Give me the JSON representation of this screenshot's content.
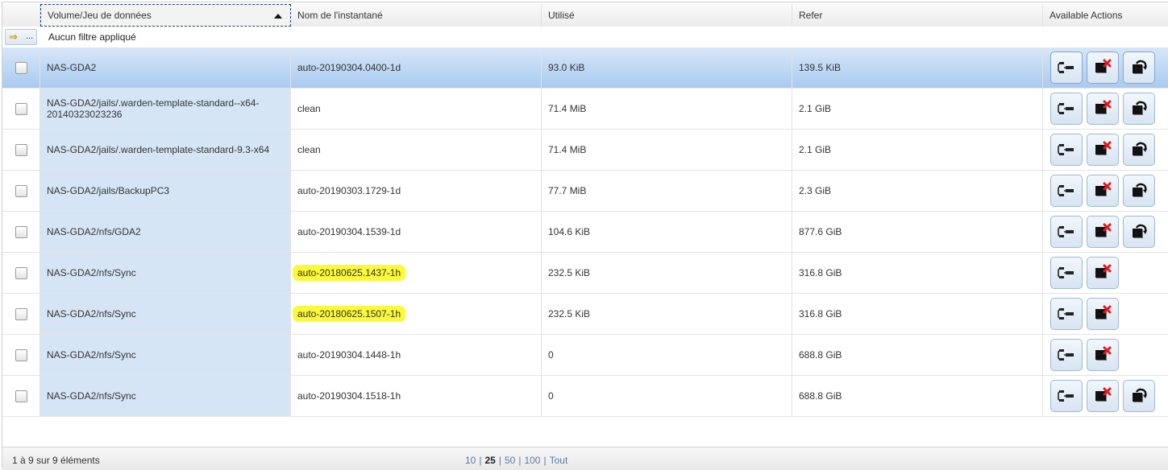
{
  "columns": {
    "volume": "Volume/Jeu de données",
    "snapshot": "Nom de l'instantané",
    "used": "Utilisé",
    "refer": "Refer",
    "actions": "Available Actions"
  },
  "filter": {
    "button_dots": "...",
    "status": "Aucun filtre appliqué"
  },
  "rows": [
    {
      "volume": "NAS-GDA2",
      "snapshot": "auto-20190304.0400-1d",
      "used": "93.0 KiB",
      "refer": "139.5 KiB",
      "selected": true,
      "highlighted": false,
      "rollback": true
    },
    {
      "volume": "NAS-GDA2/jails/.warden-template-standard--x64-20140323023236",
      "snapshot": "clean",
      "used": "71.4 MiB",
      "refer": "2.1 GiB",
      "selected": false,
      "highlighted": false,
      "rollback": true
    },
    {
      "volume": "NAS-GDA2/jails/.warden-template-standard-9.3-x64",
      "snapshot": "clean",
      "used": "71.4 MiB",
      "refer": "2.1 GiB",
      "selected": false,
      "highlighted": false,
      "rollback": true
    },
    {
      "volume": "NAS-GDA2/jails/BackupPC3",
      "snapshot": "auto-20190303.1729-1d",
      "used": "77.7 MiB",
      "refer": "2.3 GiB",
      "selected": false,
      "highlighted": false,
      "rollback": true
    },
    {
      "volume": "NAS-GDA2/nfs/GDA2",
      "snapshot": "auto-20190304.1539-1d",
      "used": "104.6 KiB",
      "refer": "877.6 GiB",
      "selected": false,
      "highlighted": false,
      "rollback": true
    },
    {
      "volume": "NAS-GDA2/nfs/Sync",
      "snapshot": "auto-20180625.1437-1h",
      "used": "232.5 KiB",
      "refer": "316.8 GiB",
      "selected": false,
      "highlighted": true,
      "rollback": false
    },
    {
      "volume": "NAS-GDA2/nfs/Sync",
      "snapshot": "auto-20180625.1507-1h",
      "used": "232.5 KiB",
      "refer": "316.8 GiB",
      "selected": false,
      "highlighted": true,
      "rollback": false
    },
    {
      "volume": "NAS-GDA2/nfs/Sync",
      "snapshot": "auto-20190304.1448-1h",
      "used": "0",
      "refer": "688.8 GiB",
      "selected": false,
      "highlighted": false,
      "rollback": false
    },
    {
      "volume": "NAS-GDA2/nfs/Sync",
      "snapshot": "auto-20190304.1518-1h",
      "used": "0",
      "refer": "688.8 GiB",
      "selected": false,
      "highlighted": false,
      "rollback": true
    }
  ],
  "footer": {
    "summary": "1 à 9 sur 9 éléments",
    "page_sizes": [
      "10",
      "25",
      "50",
      "100",
      "Tout"
    ],
    "current_page_size": "25"
  },
  "icons": {
    "clone": "clone-snapshot-icon",
    "destroy": "destroy-snapshot-icon",
    "rollback": "rollback-snapshot-icon"
  },
  "colors": {
    "selected_row": "#a9cbf0",
    "volume_column": "#d6e5f6",
    "highlight": "#fbf93a",
    "delete_mark": "#e0191c"
  }
}
